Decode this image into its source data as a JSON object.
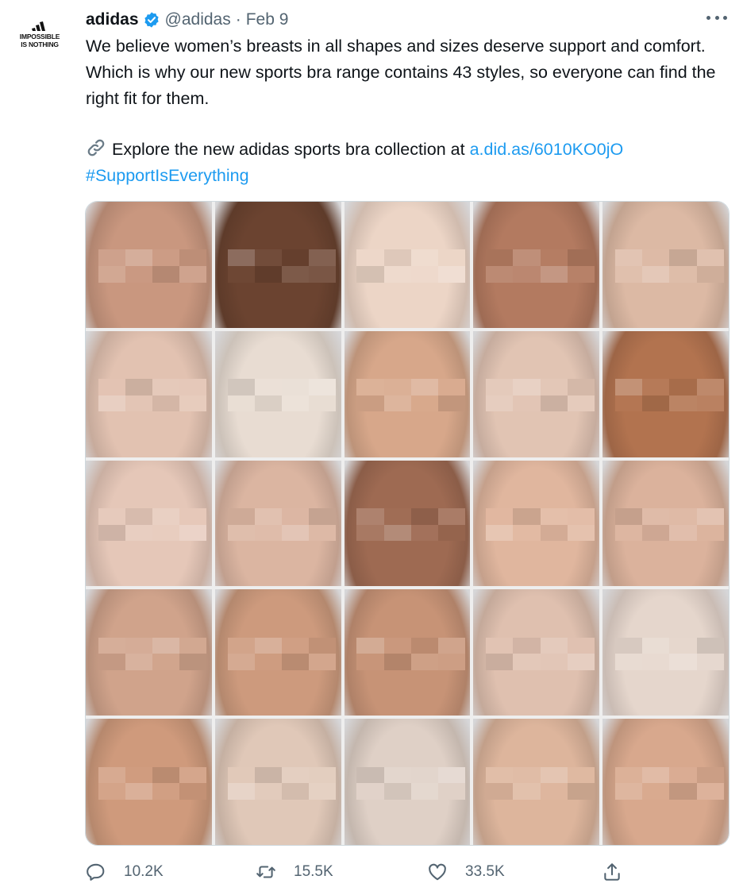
{
  "avatar": {
    "alt": "adidas",
    "slogan": "IMPOSSIBLE\nIS NOTHING"
  },
  "tweet": {
    "author_name": "adidas",
    "handle": "@adidas",
    "separator": "·",
    "date": "Feb 9",
    "body": "We believe women’s breasts in all shapes and sizes deserve support and comfort. Which is why our new sports bra range contains 43 styles, so everyone can find the right fit for them.",
    "cta_text": "Explore the new adidas sports bra collection at",
    "cta_link": "a.did.as/6010KO0jO",
    "hashtag": "#SupportIsEverything"
  },
  "media": {
    "grid_rows": 5,
    "grid_cols": 5,
    "background_color": "#d6d6d8",
    "tiles": [
      {
        "tone": "#c9977f"
      },
      {
        "tone": "#6b4330"
      },
      {
        "tone": "#ecd5c6"
      },
      {
        "tone": "#b37a60"
      },
      {
        "tone": "#dcb9a4"
      },
      {
        "tone": "#e2c2b1"
      },
      {
        "tone": "#e8dcd2"
      },
      {
        "tone": "#d7a78a"
      },
      {
        "tone": "#e1c4b3"
      },
      {
        "tone": "#b2734f"
      },
      {
        "tone": "#e5c7b8"
      },
      {
        "tone": "#dbb5a1"
      },
      {
        "tone": "#9e6a52"
      },
      {
        "tone": "#e0b69e"
      },
      {
        "tone": "#dbb29c"
      },
      {
        "tone": "#d0a38b"
      },
      {
        "tone": "#cd9a7d"
      },
      {
        "tone": "#c79376"
      },
      {
        "tone": "#dfc0af"
      },
      {
        "tone": "#e5d6cc"
      },
      {
        "tone": "#cf9a7c"
      },
      {
        "tone": "#e0c8b8"
      },
      {
        "tone": "#dfd0c6"
      },
      {
        "tone": "#ddb59c"
      },
      {
        "tone": "#d8a88d"
      }
    ]
  },
  "actions": {
    "reply_count": "10.2K",
    "retweet_count": "15.5K",
    "like_count": "33.5K"
  },
  "colors": {
    "text": "#0f1419",
    "secondary": "#536471",
    "link": "#1d9bf0",
    "border": "#cfd9de",
    "verified": "#1d9bf0"
  }
}
